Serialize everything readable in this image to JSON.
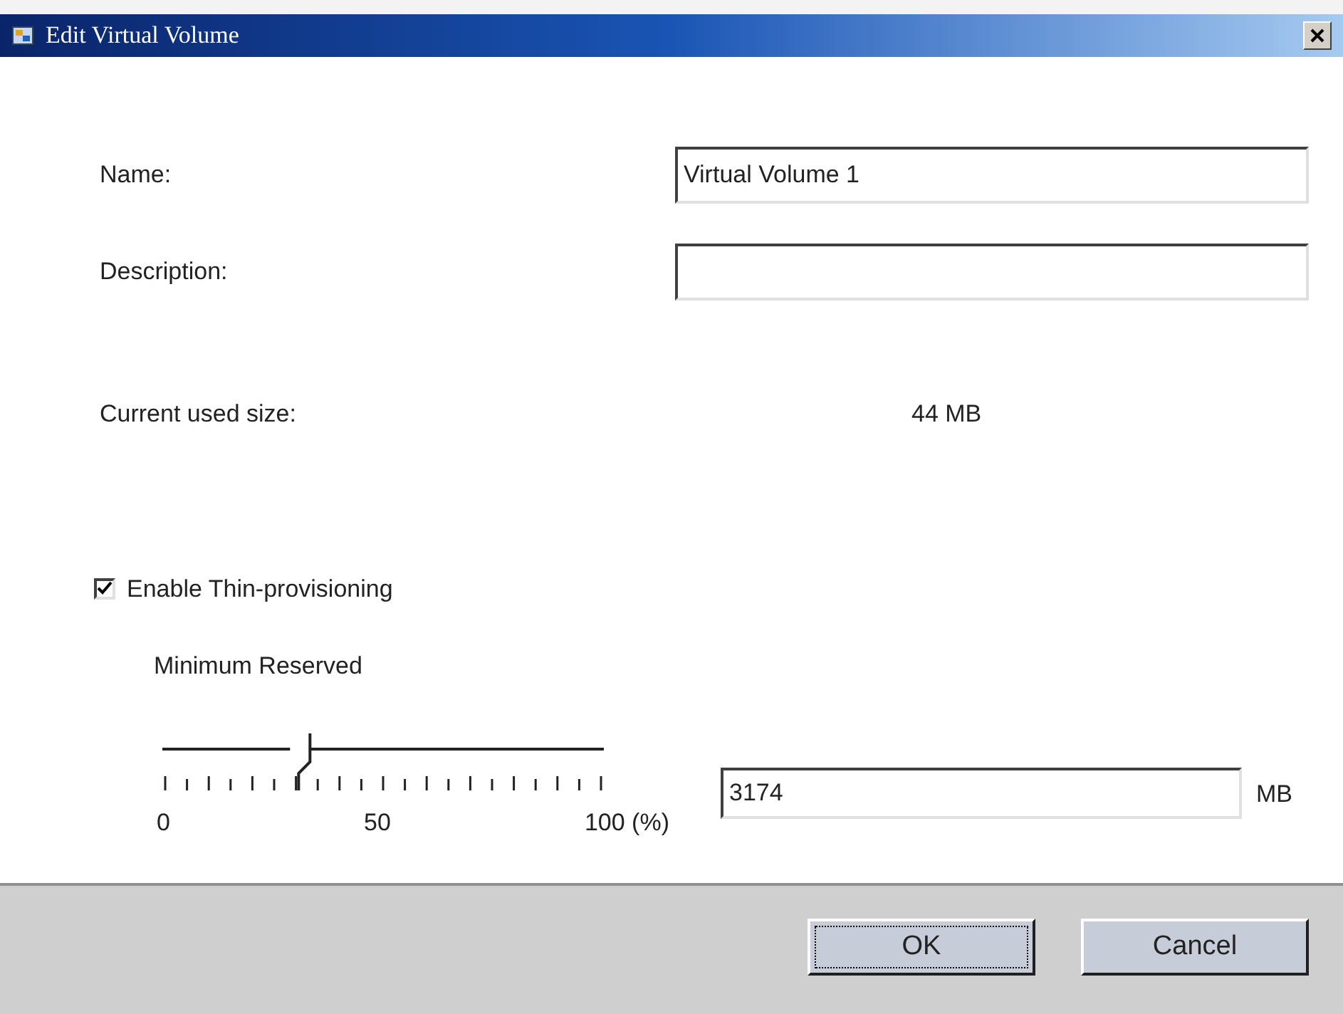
{
  "window": {
    "title": "Edit Virtual Volume"
  },
  "fields": [
    {
      "label": "Name:",
      "value": "Virtual Volume 1"
    },
    {
      "label": "Description:"
    }
  ],
  "current_size": {
    "label": "Current used size:",
    "value": "44 MB"
  },
  "thin_provisioning": {
    "label": "Enable Thin-provisioning",
    "checked": true
  },
  "minimum_reserved": {
    "label": "Minimum Reserved",
    "level": 0.33,
    "tick_labels": [
      "0",
      "50",
      "100 (%)"
    ],
    "value": "3174",
    "unit": "MB"
  },
  "buttons": [
    {
      "label": "OK",
      "focused": true
    },
    {
      "label": "Cancel",
      "focused": false
    }
  ]
}
